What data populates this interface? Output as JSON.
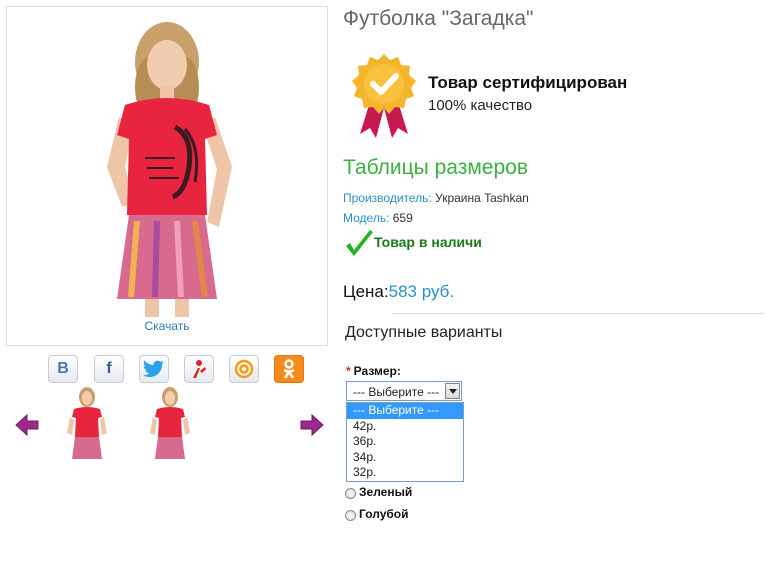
{
  "product": {
    "title": "Футболка \"Загадка\"",
    "download_label": "Скачать"
  },
  "certification": {
    "title": "Товар сертифицирован",
    "subtitle": "100% качество",
    "icon": "certified-badge-icon",
    "color": "#f4b52a"
  },
  "size_tables_link": "Таблицы размеров",
  "meta": {
    "manufacturer_label": "Производитель:",
    "manufacturer_value": "Украина Tashkan",
    "model_label": "Модель:",
    "model_value": "659"
  },
  "stock": {
    "text": "Товар в наличи",
    "icon": "green-check-icon"
  },
  "price": {
    "label": "Цена:",
    "value": "583 руб."
  },
  "variants_header": "Доступные варианты",
  "size_select": {
    "label": "Размер:",
    "required_mark": "*",
    "selected": "--- Выберите ---",
    "options": [
      "--- Выберите ---",
      "42р.",
      "36р.",
      "34р.",
      "32р."
    ]
  },
  "color_options": [
    "Зеленый",
    "Голубой"
  ],
  "social": {
    "vk": "В",
    "facebook": "f",
    "icons": [
      "vk-icon",
      "facebook-icon",
      "twitter-icon",
      "moimir-icon",
      "mailru-icon",
      "odnoklassniki-icon"
    ]
  },
  "colors": {
    "accent_green": "#3cb043",
    "link_blue": "#2a8fc4",
    "arrow_purple": "#9c2a8c"
  }
}
